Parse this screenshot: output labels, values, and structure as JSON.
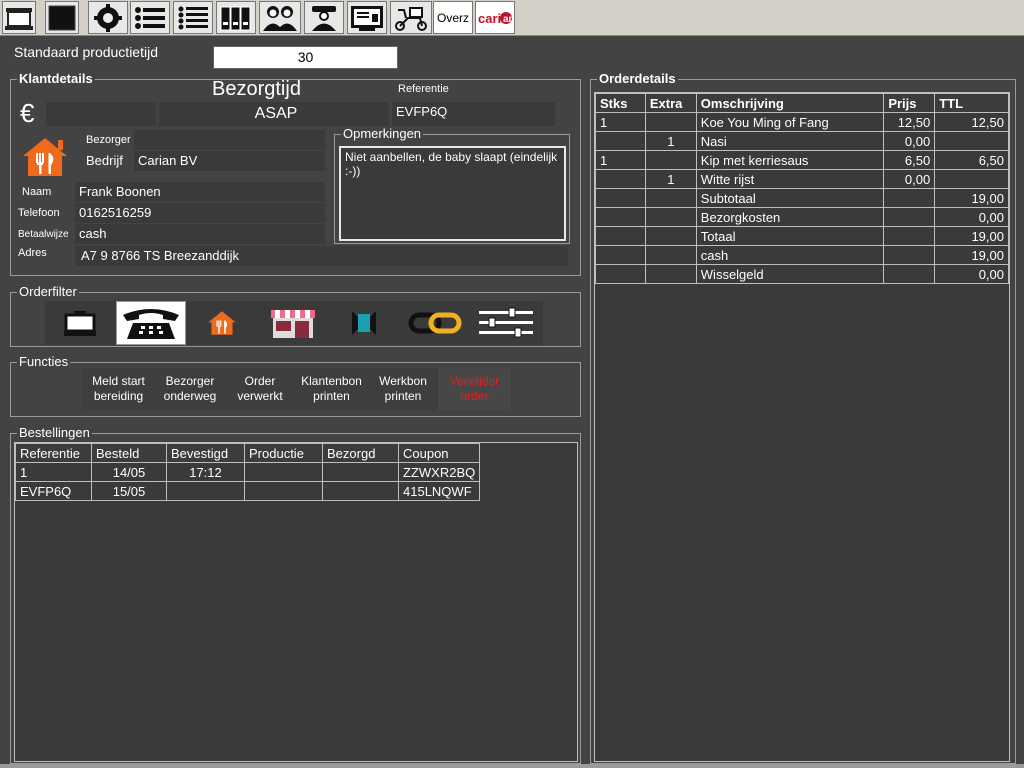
{
  "toolbar": {
    "overz_label": "Overz",
    "logo_text": "carian",
    "icons": [
      "monitor-icon",
      "screen-icon",
      "gear-icon",
      "list-icon",
      "list-detail-icon",
      "binders-icon",
      "customers-icon",
      "driver-icon",
      "report-icon",
      "delivery-scooter-icon"
    ]
  },
  "production": {
    "label": "Standaard productietijd",
    "value": "30"
  },
  "client": {
    "title": "Klantdetails",
    "currency_symbol": "€",
    "delivery_time_label": "Bezorgtijd",
    "delivery_time": "ASAP",
    "reference_label": "Referentie",
    "reference": "EVFP6Q",
    "courier_label": "Bezorger",
    "courier": "",
    "company_label": "Bedrijf",
    "company": "Carian BV",
    "remarks_title": "Opmerkingen",
    "remarks": "Niet aanbellen, de baby slaapt (eindelijk :-))",
    "name_label": "Naam",
    "name": "Frank Boonen",
    "phone_label": "Telefoon",
    "phone": "0162516259",
    "payment_label": "Betaalwijze",
    "payment": "cash",
    "address_label": "Adres",
    "address": "A7 9 8766 TS Breezanddijk"
  },
  "orderfilter": {
    "title": "Orderfilter",
    "icons": [
      "monitor-filter-icon",
      "telephone-icon",
      "delivery-house-icon",
      "shop-icon",
      "pickup-icon",
      "link-icon",
      "sliders-icon"
    ]
  },
  "functions": {
    "title": "Functies",
    "buttons": [
      {
        "line1": "Meld start",
        "line2": "bereiding"
      },
      {
        "line1": "Bezorger",
        "line2": "onderweg"
      },
      {
        "line1": "Order",
        "line2": "verwerkt"
      },
      {
        "line1": "Klantenbon",
        "line2": "printen"
      },
      {
        "line1": "Werkbon",
        "line2": "printen"
      },
      {
        "line1": "Verwijder",
        "line2": "order"
      }
    ],
    "delete_color": "#e02020"
  },
  "orders": {
    "title": "Bestellingen",
    "columns": [
      "Referentie",
      "Besteld",
      "Bevestigd",
      "Productie",
      "Bezorgd",
      "Coupon"
    ],
    "rows": [
      [
        "1",
        "14/05",
        "17:12",
        "",
        "",
        "ZZWXR2BQ"
      ],
      [
        "EVFP6Q",
        "15/05",
        "",
        "",
        "",
        "415LNQWF"
      ]
    ]
  },
  "orderdetails": {
    "title": "Orderdetails",
    "columns": [
      "Stks",
      "Extra",
      "Omschrijving",
      "Prijs",
      "TTL"
    ],
    "rows": [
      [
        "1",
        "",
        "Koe You Ming of Fang",
        "12,50",
        "12,50"
      ],
      [
        "",
        "1",
        "Nasi",
        "0,00",
        ""
      ],
      [
        "1",
        "",
        "Kip met kerriesaus",
        "6,50",
        "6,50"
      ],
      [
        "",
        "1",
        "Witte rijst",
        "0,00",
        ""
      ],
      [
        "",
        "",
        "Subtotaal",
        "",
        "19,00"
      ],
      [
        "",
        "",
        "Bezorgkosten",
        "",
        "0,00"
      ],
      [
        "",
        "",
        "Totaal",
        "",
        "19,00"
      ],
      [
        "",
        "",
        "cash",
        "",
        "19,00"
      ],
      [
        "",
        "",
        "Wisselgeld",
        "",
        "0,00"
      ]
    ]
  },
  "colors": {
    "background": "#434343",
    "field": "#3a3a3a",
    "accent_orange": "#f06a1e",
    "delete_red": "#e02020"
  }
}
